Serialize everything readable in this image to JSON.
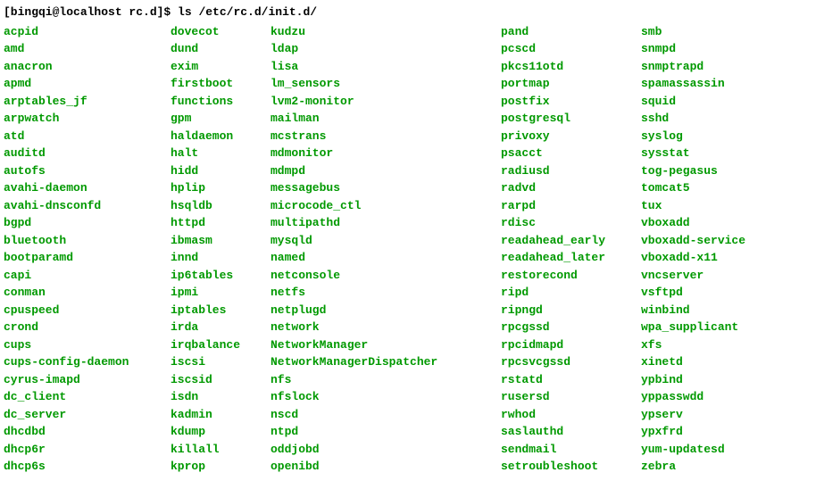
{
  "prompt": {
    "user_host": "[bingqi@localhost rc.d]$",
    "command": "ls /etc/rc.d/init.d/"
  },
  "cols": [
    [
      "acpid",
      "amd",
      "anacron",
      "apmd",
      "arptables_jf",
      "arpwatch",
      "atd",
      "auditd",
      "autofs",
      "avahi-daemon",
      "avahi-dnsconfd",
      "bgpd",
      "bluetooth",
      "bootparamd",
      "capi",
      "conman",
      "cpuspeed",
      "crond",
      "cups",
      "cups-config-daemon",
      "cyrus-imapd",
      "dc_client",
      "dc_server",
      "dhcdbd",
      "dhcp6r",
      "dhcp6s"
    ],
    [
      "dovecot",
      "dund",
      "exim",
      "firstboot",
      "functions",
      "gpm",
      "haldaemon",
      "halt",
      "hidd",
      "hplip",
      "hsqldb",
      "httpd",
      "ibmasm",
      "innd",
      "ip6tables",
      "ipmi",
      "iptables",
      "irda",
      "irqbalance",
      "iscsi",
      "iscsid",
      "isdn",
      "kadmin",
      "kdump",
      "killall",
      "kprop"
    ],
    [
      "kudzu",
      "ldap",
      "lisa",
      "lm_sensors",
      "lvm2-monitor",
      "mailman",
      "mcstrans",
      "mdmonitor",
      "mdmpd",
      "messagebus",
      "microcode_ctl",
      "multipathd",
      "mysqld",
      "named",
      "netconsole",
      "netfs",
      "netplugd",
      "network",
      "NetworkManager",
      "NetworkManagerDispatcher",
      "nfs",
      "nfslock",
      "nscd",
      "ntpd",
      "oddjobd",
      "openibd"
    ],
    [
      "pand",
      "pcscd",
      "pkcs11otd",
      "portmap",
      "postfix",
      "postgresql",
      "privoxy",
      "psacct",
      "radiusd",
      "radvd",
      "rarpd",
      "rdisc",
      "readahead_early",
      "readahead_later",
      "restorecond",
      "ripd",
      "ripngd",
      "rpcgssd",
      "rpcidmapd",
      "rpcsvcgssd",
      "rstatd",
      "rusersd",
      "rwhod",
      "saslauthd",
      "sendmail",
      "setroubleshoot"
    ],
    [
      "smb",
      "snmpd",
      "snmptrapd",
      "spamassassin",
      "squid",
      "sshd",
      "syslog",
      "sysstat",
      "tog-pegasus",
      "tomcat5",
      "tux",
      "vboxadd",
      "vboxadd-service",
      "vboxadd-x11",
      "vncserver",
      "vsftpd",
      "winbind",
      "wpa_supplicant",
      "xfs",
      "xinetd",
      "ypbind",
      "yppasswdd",
      "ypserv",
      "ypxfrd",
      "yum-updatesd",
      "zebra"
    ]
  ]
}
